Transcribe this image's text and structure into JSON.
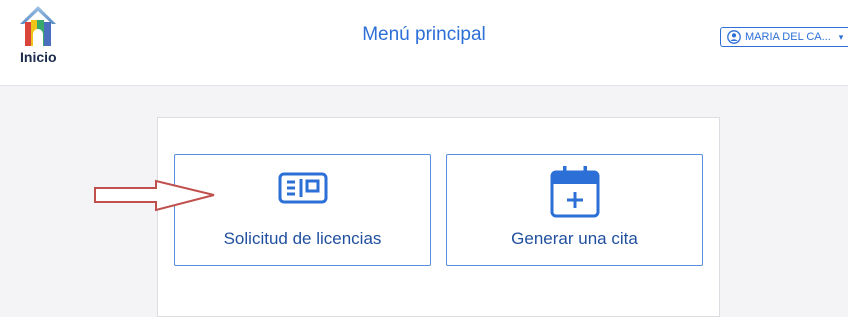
{
  "header": {
    "home_label": "Inicio",
    "title": "Menú principal",
    "user_name": "MARIA DEL CA...",
    "user_caret": "▾"
  },
  "menu": {
    "items": [
      {
        "label": "Solicitud de licencias",
        "icon": "id-card-icon"
      },
      {
        "label": "Generar una cita",
        "icon": "calendar-plus-icon"
      }
    ]
  },
  "colors": {
    "accent": "#2c6fd6",
    "tile_border": "#5a8fdc",
    "tile_text": "#1f4f9e",
    "annotation_arrow": "#c0504d"
  }
}
